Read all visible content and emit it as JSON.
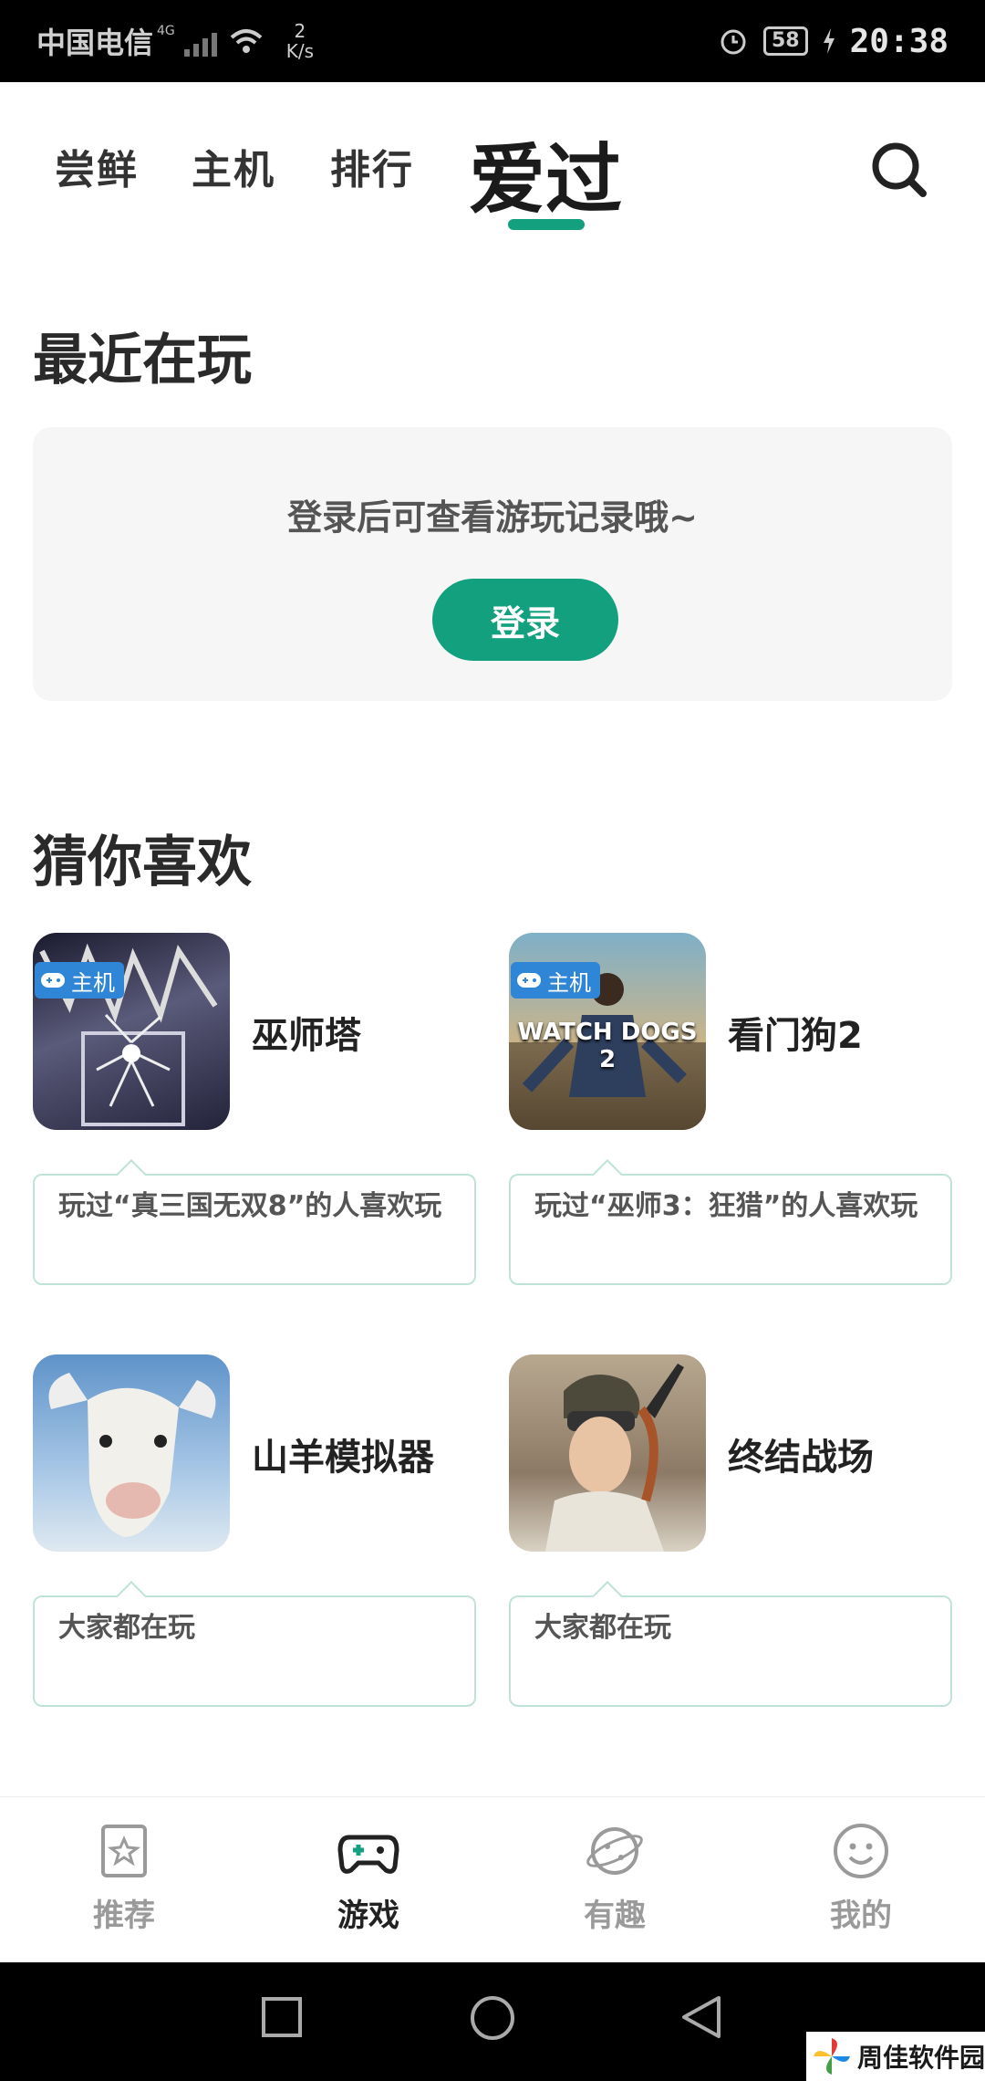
{
  "status_bar": {
    "carrier": "中国电信",
    "network": "4G",
    "speed_value": "2",
    "speed_unit": "K/s",
    "battery": "58",
    "time": "20:38"
  },
  "top_tabs": [
    {
      "label": "尝鲜",
      "active": false
    },
    {
      "label": "主机",
      "active": false
    },
    {
      "label": "排行",
      "active": false
    },
    {
      "label": "爱过",
      "active": true
    }
  ],
  "recent": {
    "title": "最近在玩",
    "message": "登录后可查看游玩记录哦~",
    "login_label": "登录"
  },
  "recommend": {
    "title": "猜你喜欢",
    "games": [
      {
        "name": "巫师塔",
        "badge": "主机",
        "reason": "玩过“真三国无双8”的人喜欢玩"
      },
      {
        "name": "看门狗2",
        "badge": "主机",
        "cover_text": "WATCH DOGS 2",
        "reason": "玩过“巫师3：狂猎”的人喜欢玩"
      },
      {
        "name": "山羊模拟器",
        "badge": "",
        "reason": "大家都在玩"
      },
      {
        "name": "终结战场",
        "badge": "",
        "reason": "大家都在玩"
      }
    ]
  },
  "bottom_nav": [
    {
      "label": "推荐",
      "icon": "star-bookmark-icon",
      "active": false
    },
    {
      "label": "游戏",
      "icon": "gamepad-icon",
      "active": true
    },
    {
      "label": "有趣",
      "icon": "planet-icon",
      "active": false
    },
    {
      "label": "我的",
      "icon": "smiley-icon",
      "active": false
    }
  ],
  "watermark": "周佳软件园",
  "colors": {
    "accent": "#12a07e",
    "badge": "#2f86d6"
  }
}
